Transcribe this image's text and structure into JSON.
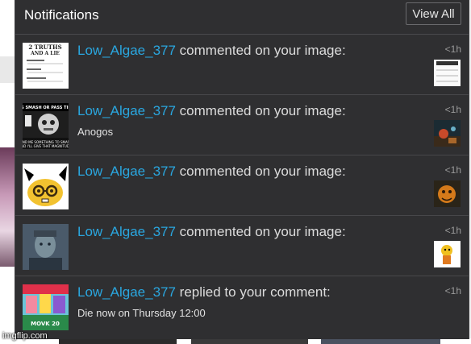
{
  "panel": {
    "title": "Notifications",
    "view_all_label": "View All"
  },
  "notifications": [
    {
      "username": "Low_Algae_377",
      "action": " commented on your image:",
      "comment": "",
      "time": "<1h",
      "avatar_icon": "meme-list-avatar",
      "thumb_icon": "meme-list-thumbnail"
    },
    {
      "username": "Low_Algae_377",
      "action": " commented on your image:",
      "comment": "Anogos",
      "time": "<1h",
      "avatar_icon": "smash-or-pass-avatar",
      "thumb_icon": "night-scene-thumbnail"
    },
    {
      "username": "Low_Algae_377",
      "action": " commented on your image:",
      "comment": "",
      "time": "<1h",
      "avatar_icon": "glasses-face-avatar",
      "thumb_icon": "orange-creature-thumbnail"
    },
    {
      "username": "Low_Algae_377",
      "action": " commented on your image:",
      "comment": "",
      "time": "<1h",
      "avatar_icon": "portrait-avatar",
      "thumb_icon": "cartoon-thumbnail"
    },
    {
      "username": "Low_Algae_377",
      "action": " replied to your comment:",
      "comment": "Die now on Thursday 12:00",
      "time": "<1h",
      "avatar_icon": "colorful-collage-avatar",
      "thumb_icon": ""
    }
  ],
  "watermark": "imgflip.com",
  "colors": {
    "panel_bg": "#2f2f31",
    "username": "#2aa7e0",
    "divider": "#47474a"
  }
}
